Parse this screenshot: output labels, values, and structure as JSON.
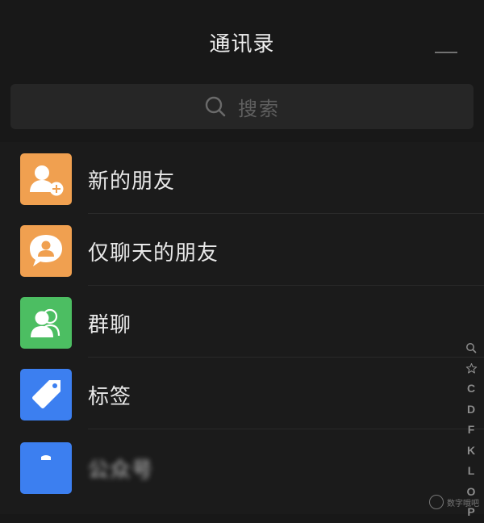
{
  "header": {
    "title": "通讯录"
  },
  "search": {
    "placeholder": "搜索"
  },
  "colors": {
    "orange": "#f0a050",
    "green": "#4cbe62",
    "blue": "#3c7ff0",
    "background": "#1b1b1b"
  },
  "list": {
    "items": [
      {
        "label": "新的朋友",
        "icon": "add-friend-icon"
      },
      {
        "label": "仅聊天的朋友",
        "icon": "chat-only-icon"
      },
      {
        "label": "群聊",
        "icon": "group-chat-icon"
      },
      {
        "label": "标签",
        "icon": "tag-icon"
      },
      {
        "label": "公众号",
        "icon": "official-account-icon"
      }
    ]
  },
  "index_bar": {
    "letters": [
      "C",
      "D",
      "F",
      "K",
      "L",
      "O",
      "P"
    ]
  },
  "watermark": {
    "text": "数字哦吧"
  }
}
